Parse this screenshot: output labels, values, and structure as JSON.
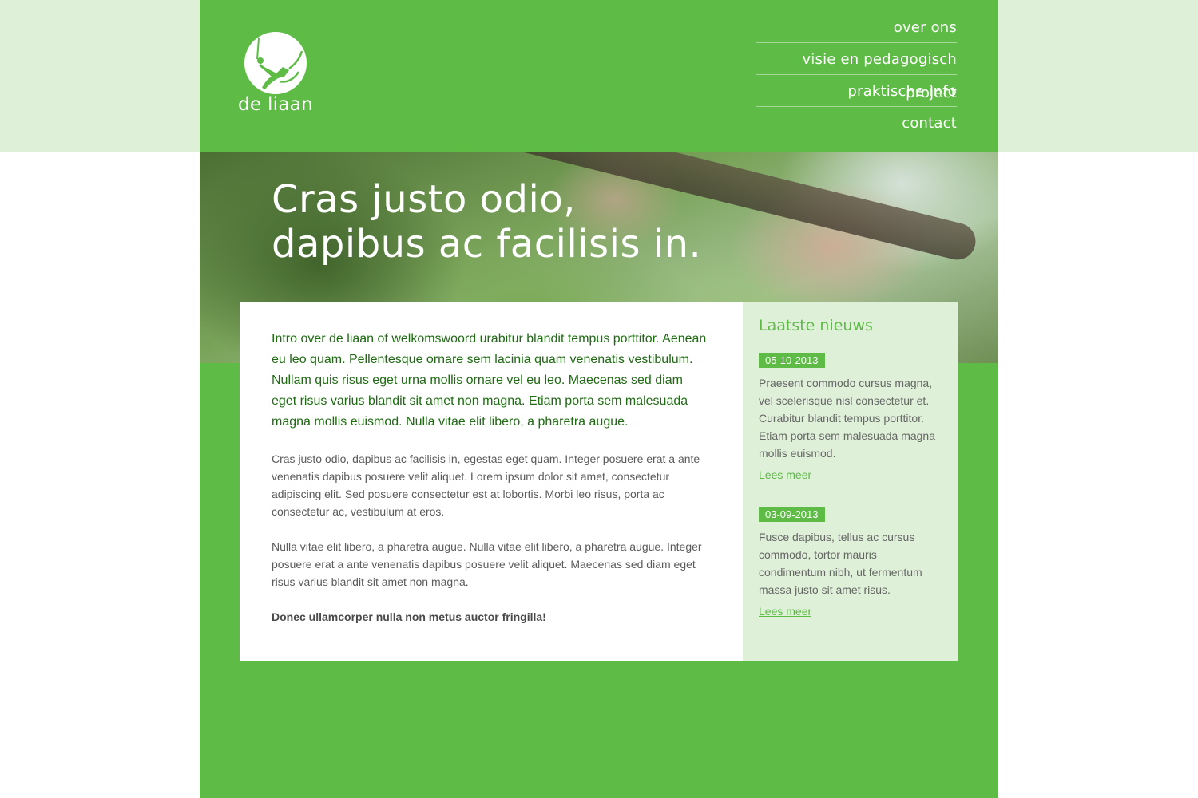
{
  "brand": {
    "name": "de liaan",
    "colors": {
      "primary": "#5dbb46",
      "light": "#dff0d8",
      "intro_text": "#1e6b12"
    },
    "logo_icon": "climber-in-circle-icon"
  },
  "nav": {
    "items": [
      {
        "label": "over ons"
      },
      {
        "label": "visie en pedagogisch project"
      },
      {
        "label": "praktische info"
      },
      {
        "label": "contact"
      }
    ]
  },
  "hero": {
    "title_line1": "Cras justo odio,",
    "title_line2": "dapibus ac facilisis in."
  },
  "main": {
    "intro": "Intro over de liaan of welkomswoord urabitur blandit tempus porttitor. Aenean eu leo quam. Pellentesque ornare sem lacinia quam venenatis vestibulum. Nullam quis risus eget urna mollis ornare vel eu leo. Maecenas sed diam eget risus varius blandit sit amet non magna. Etiam porta sem malesuada magna mollis euismod. Nulla vitae elit libero, a pharetra augue.",
    "paragraph1": "Cras justo odio, dapibus ac facilisis in, egestas eget quam. Integer posuere erat a ante venenatis dapibus posuere velit aliquet. Lorem ipsum dolor sit amet, consectetur adipiscing elit. Sed posuere consectetur est at lobortis. Morbi leo risus, porta ac consectetur ac, vestibulum at eros.",
    "paragraph2": "Nulla vitae elit libero, a pharetra augue. Nulla vitae elit libero, a pharetra augue. Integer posuere erat a ante venenatis dapibus posuere velit aliquet. Maecenas sed diam eget risus varius blandit sit amet non magna.",
    "paragraph3": "Donec ullamcorper nulla non metus auctor fringilla!"
  },
  "sidebar": {
    "title": "Laatste nieuws",
    "news": [
      {
        "date": "05-10-2013",
        "text": "Praesent commodo cursus magna, vel scelerisque nisl consectetur et. Curabitur blandit tempus porttitor. Etiam porta sem malesuada magna mollis euismod.",
        "link": "Lees meer"
      },
      {
        "date": "03-09-2013",
        "text": "Fusce dapibus, tellus ac cursus commodo, tortor mauris condimentum nibh, ut fermentum massa justo sit amet risus.",
        "link": "Lees meer"
      }
    ]
  }
}
